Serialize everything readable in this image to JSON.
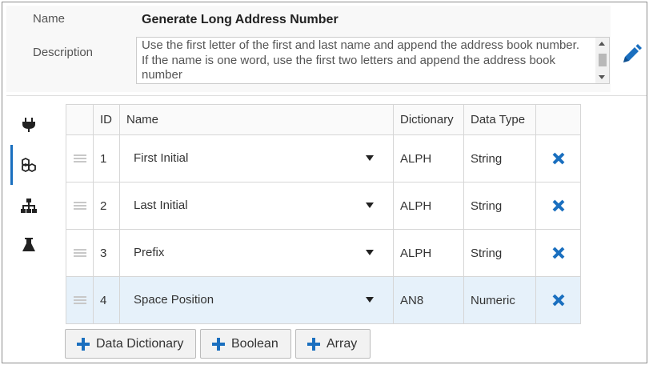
{
  "header": {
    "name_label": "Name",
    "name_value": "Generate Long Address Number",
    "description_label": "Description",
    "description_value": "Use the first letter of the first and last name and append the address book number.  If the name is one word, use the first two letters and append the address book number"
  },
  "sidebar": {
    "items": [
      {
        "icon": "plug-icon",
        "active": false
      },
      {
        "icon": "cubes-icon",
        "active": true
      },
      {
        "icon": "sitemap-icon",
        "active": false
      },
      {
        "icon": "flask-icon",
        "active": false
      }
    ]
  },
  "table": {
    "columns": [
      "ID",
      "Name",
      "Dictionary",
      "Data Type"
    ],
    "rows": [
      {
        "id": "1",
        "name": "First Initial",
        "dictionary": "ALPH",
        "data_type": "String"
      },
      {
        "id": "2",
        "name": "Last Initial",
        "dictionary": "ALPH",
        "data_type": "String"
      },
      {
        "id": "3",
        "name": "Prefix",
        "dictionary": "ALPH",
        "data_type": "String"
      },
      {
        "id": "4",
        "name": "Space Position",
        "dictionary": "AN8",
        "data_type": "Numeric"
      }
    ],
    "selected_row": 4
  },
  "buttons": {
    "data_dictionary": "Data Dictionary",
    "boolean": "Boolean",
    "array": "Array"
  },
  "colors": {
    "accent": "#1a6fbf",
    "selected_row": "#e6f1fa"
  }
}
